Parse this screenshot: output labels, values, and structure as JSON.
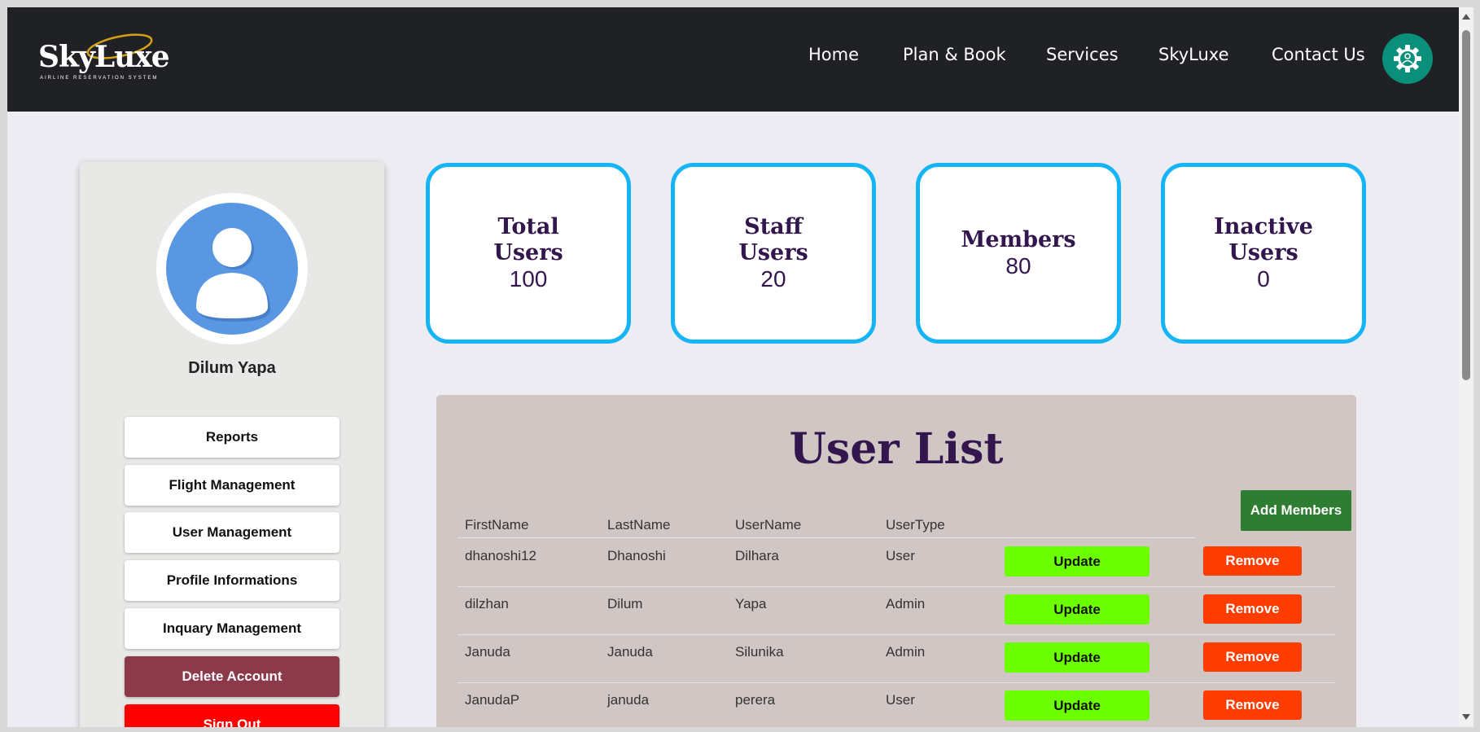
{
  "header": {
    "logo_text": "SkyLuxe",
    "logo_subtitle": "AIRLINE RESERVATION SYSTEM",
    "nav": [
      {
        "label": "Home"
      },
      {
        "label": "Plan & Book"
      },
      {
        "label": "Services"
      },
      {
        "label": "SkyLuxe"
      },
      {
        "label": "Contact Us"
      }
    ],
    "settings_icon": "gear-user-icon"
  },
  "sidebar": {
    "avatar_icon": "user-avatar-icon",
    "user_name": "Dilum Yapa",
    "buttons": [
      {
        "label": "Reports"
      },
      {
        "label": "Flight Management"
      },
      {
        "label": "User Management"
      },
      {
        "label": "Profile Informations"
      },
      {
        "label": "Inquary Management"
      },
      {
        "label": "Delete Account"
      },
      {
        "label": "Sign Out"
      }
    ]
  },
  "stats": [
    {
      "title": "Total Users",
      "value": "100"
    },
    {
      "title": "Staff Users",
      "value": "20"
    },
    {
      "title": "Members",
      "value": "80"
    },
    {
      "title": "Inactive Users",
      "value": "0"
    }
  ],
  "user_list": {
    "title": "User List",
    "add_button": "Add Members",
    "columns": [
      "FirstName",
      "LastName",
      "UserName",
      "UserType"
    ],
    "update_label": "Update",
    "remove_label": "Remove",
    "rows": [
      {
        "first": "dhanoshi12",
        "last": "Dhanoshi",
        "user": "Dilhara",
        "type": "User"
      },
      {
        "first": "dilzhan",
        "last": "Dilum",
        "user": "Yapa",
        "type": "Admin"
      },
      {
        "first": "Januda",
        "last": "Januda",
        "user": "Silunika",
        "type": "Admin"
      },
      {
        "first": "JanudaP",
        "last": "januda",
        "user": "perera",
        "type": "User"
      }
    ]
  },
  "colors": {
    "header_bg": "#202124",
    "card_border": "#14b4f5",
    "title_purple": "#33164d",
    "update_green": "#6cff00",
    "remove_red": "#ff3d00",
    "add_green": "#2e7d32",
    "delete_maroon": "#8c3a4a",
    "signout_red": "#ff0000"
  }
}
